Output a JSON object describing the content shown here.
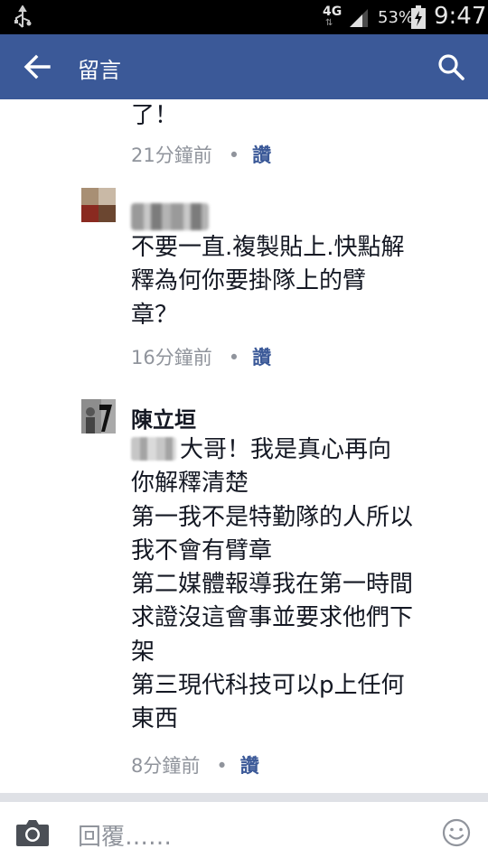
{
  "status_bar": {
    "network": "4G",
    "battery": "53%",
    "time": "9:47",
    "icons": [
      "usb-icon",
      "signal-icon",
      "battery-icon"
    ]
  },
  "app_bar": {
    "title": "留言",
    "icons": [
      "back-arrow-icon",
      "search-icon"
    ]
  },
  "comments": [
    {
      "name": "",
      "body_lines": [
        "了！"
      ],
      "time": "21分鐘前",
      "separator": "•",
      "like_label": "讚"
    },
    {
      "name": "",
      "body_lines": [
        "不要一直.複製貼上.快點解",
        "釋為何你要掛隊上的臂",
        "章？"
      ],
      "time": "16分鐘前",
      "separator": "•",
      "like_label": "讚"
    },
    {
      "name": "陳立垣",
      "body_lines": [
        "大哥！我是真心再向",
        "你解釋清楚",
        "第一我不是特勤隊的人所以",
        "我不會有臂章",
        "第二媒體報導我在第一時間",
        "求證沒這會事並要求他們下",
        "架",
        "第三現代科技可以p上任何",
        "東西"
      ],
      "time": "8分鐘前",
      "separator": "•",
      "like_label": "讚"
    }
  ],
  "composer": {
    "placeholder": "回覆……",
    "icons": [
      "camera-icon",
      "emoji-icon"
    ]
  },
  "colors": {
    "app_bar": "#3b5998",
    "status_bar": "#000000",
    "text": "#141823",
    "meta": "#90949c",
    "link": "#3b5998",
    "divider": "#dfe1e6"
  }
}
